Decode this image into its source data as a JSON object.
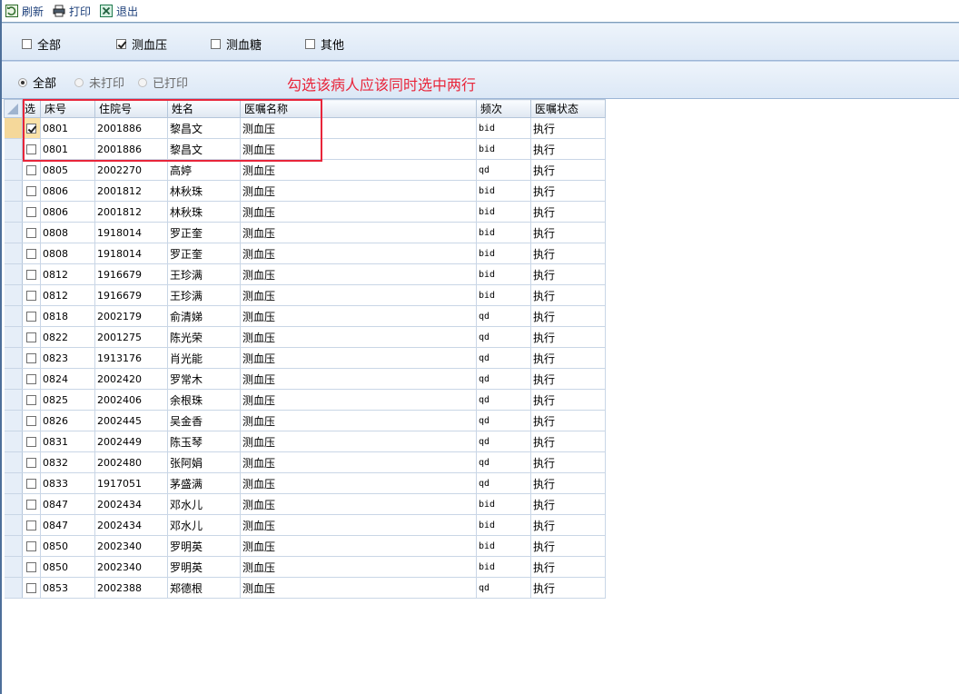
{
  "toolbar": {
    "refresh_label": "刷新",
    "print_label": "打印",
    "exit_label": "退出"
  },
  "type_filter": {
    "all_label": "全部",
    "all_checked": false,
    "bp_label": "测血压",
    "bp_checked": true,
    "glucose_label": "测血糖",
    "glucose_checked": false,
    "other_label": "其他",
    "other_checked": false
  },
  "print_filter": {
    "all_label": "全部",
    "unprinted_label": "未打印",
    "printed_label": "已打印",
    "selected": "all"
  },
  "annotation": {
    "text": "勾选该病人应该同时选中两行",
    "color": "#e8253a"
  },
  "grid": {
    "columns": [
      "选",
      "床号",
      "住院号",
      "姓名",
      "医嘱名称",
      "频次",
      "医嘱状态"
    ],
    "rows": [
      {
        "checked": true,
        "bed": "0801",
        "admission": "2001886",
        "name": "黎昌文",
        "order": "测血压",
        "freq": "bid",
        "status": "执行"
      },
      {
        "checked": false,
        "bed": "0801",
        "admission": "2001886",
        "name": "黎昌文",
        "order": "测血压",
        "freq": "bid",
        "status": "执行"
      },
      {
        "checked": false,
        "bed": "0805",
        "admission": "2002270",
        "name": "高婷",
        "order": "测血压",
        "freq": "qd",
        "status": "执行"
      },
      {
        "checked": false,
        "bed": "0806",
        "admission": "2001812",
        "name": "林秋珠",
        "order": "测血压",
        "freq": "bid",
        "status": "执行"
      },
      {
        "checked": false,
        "bed": "0806",
        "admission": "2001812",
        "name": "林秋珠",
        "order": "测血压",
        "freq": "bid",
        "status": "执行"
      },
      {
        "checked": false,
        "bed": "0808",
        "admission": "1918014",
        "name": "罗正奎",
        "order": "测血压",
        "freq": "bid",
        "status": "执行"
      },
      {
        "checked": false,
        "bed": "0808",
        "admission": "1918014",
        "name": "罗正奎",
        "order": "测血压",
        "freq": "bid",
        "status": "执行"
      },
      {
        "checked": false,
        "bed": "0812",
        "admission": "1916679",
        "name": "王珍满",
        "order": "测血压",
        "freq": "bid",
        "status": "执行"
      },
      {
        "checked": false,
        "bed": "0812",
        "admission": "1916679",
        "name": "王珍满",
        "order": "测血压",
        "freq": "bid",
        "status": "执行"
      },
      {
        "checked": false,
        "bed": "0818",
        "admission": "2002179",
        "name": "俞清娣",
        "order": "测血压",
        "freq": "qd",
        "status": "执行"
      },
      {
        "checked": false,
        "bed": "0822",
        "admission": "2001275",
        "name": "陈光荣",
        "order": "测血压",
        "freq": "qd",
        "status": "执行"
      },
      {
        "checked": false,
        "bed": "0823",
        "admission": "1913176",
        "name": "肖光能",
        "order": "测血压",
        "freq": "qd",
        "status": "执行"
      },
      {
        "checked": false,
        "bed": "0824",
        "admission": "2002420",
        "name": "罗常木",
        "order": "测血压",
        "freq": "qd",
        "status": "执行"
      },
      {
        "checked": false,
        "bed": "0825",
        "admission": "2002406",
        "name": "余根珠",
        "order": "测血压",
        "freq": "qd",
        "status": "执行"
      },
      {
        "checked": false,
        "bed": "0826",
        "admission": "2002445",
        "name": "吴金香",
        "order": "测血压",
        "freq": "qd",
        "status": "执行"
      },
      {
        "checked": false,
        "bed": "0831",
        "admission": "2002449",
        "name": "陈玉琴",
        "order": "测血压",
        "freq": "qd",
        "status": "执行"
      },
      {
        "checked": false,
        "bed": "0832",
        "admission": "2002480",
        "name": "张阿娟",
        "order": "测血压",
        "freq": "qd",
        "status": "执行"
      },
      {
        "checked": false,
        "bed": "0833",
        "admission": "1917051",
        "name": "茅盛满",
        "order": "测血压",
        "freq": "qd",
        "status": "执行"
      },
      {
        "checked": false,
        "bed": "0847",
        "admission": "2002434",
        "name": "邓水儿",
        "order": "测血压",
        "freq": "bid",
        "status": "执行"
      },
      {
        "checked": false,
        "bed": "0847",
        "admission": "2002434",
        "name": "邓水儿",
        "order": "测血压",
        "freq": "bid",
        "status": "执行"
      },
      {
        "checked": false,
        "bed": "0850",
        "admission": "2002340",
        "name": "罗明英",
        "order": "测血压",
        "freq": "bid",
        "status": "执行"
      },
      {
        "checked": false,
        "bed": "0850",
        "admission": "2002340",
        "name": "罗明英",
        "order": "测血压",
        "freq": "bid",
        "status": "执行"
      },
      {
        "checked": false,
        "bed": "0853",
        "admission": "2002388",
        "name": "郑德根",
        "order": "测血压",
        "freq": "qd",
        "status": "执行"
      }
    ]
  }
}
